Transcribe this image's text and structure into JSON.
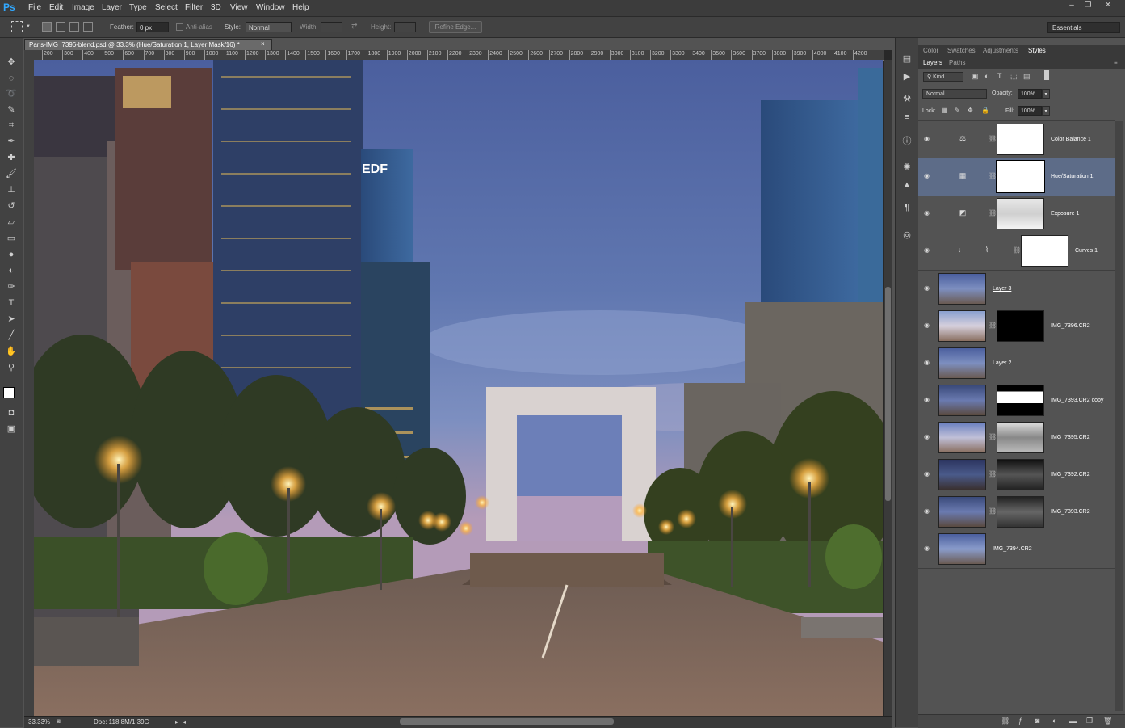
{
  "app": {
    "logo": "Ps",
    "accent": "#31a8ff"
  },
  "menu": [
    "File",
    "Edit",
    "Image",
    "Layer",
    "Type",
    "Select",
    "Filter",
    "3D",
    "View",
    "Window",
    "Help"
  ],
  "window_controls": {
    "minimize": "–",
    "restore": "❐",
    "close": "✕"
  },
  "options_bar": {
    "feather_label": "Feather:",
    "feather_value": "0 px",
    "antialias_label": "Anti-alias",
    "style_label": "Style:",
    "style_value": "Normal",
    "width_label": "Width:",
    "height_label": "Height:",
    "refine_edge": "Refine Edge...",
    "workspace": "Essentials"
  },
  "document": {
    "tab_title": "Paris-IMG_7396-blend.psd @ 33.3% (Hue/Saturation 1, Layer Mask/16) *",
    "zoom": "33.33%",
    "doc_size": "Doc: 118.8M/1.39G",
    "ruler_ticks": [
      "200",
      "300",
      "400",
      "500",
      "600",
      "700",
      "800",
      "900",
      "1000",
      "1100",
      "1200",
      "1300",
      "1400",
      "1500",
      "1600",
      "1700",
      "1800",
      "1900",
      "2000",
      "2100",
      "2200",
      "2300",
      "2400",
      "2500",
      "2600",
      "2700",
      "2800",
      "2900",
      "3000",
      "3100",
      "3200",
      "3300",
      "3400",
      "3500",
      "3600",
      "3700",
      "3800",
      "3900",
      "4000",
      "4100",
      "4200"
    ],
    "sign_text": "EDF"
  },
  "panels": {
    "top_tabs": [
      "Color",
      "Swatches",
      "Adjustments",
      "Styles"
    ],
    "top_active": "Styles",
    "layer_tabs": [
      "Layers",
      "Paths"
    ],
    "layer_active": "Layers",
    "filter_kind": "Kind",
    "blend_mode": "Normal",
    "opacity_label": "Opacity:",
    "opacity_value": "100%",
    "lock_label": "Lock:",
    "fill_label": "Fill:",
    "fill_value": "100%"
  },
  "layers": [
    {
      "name": "Color Balance 1",
      "type": "adjustment",
      "icon": "balance-icon",
      "mask": "white",
      "selected": false
    },
    {
      "name": "Hue/Saturation 1",
      "type": "adjustment",
      "icon": "hue-icon",
      "mask": "white",
      "selected": true
    },
    {
      "name": "Exposure 1",
      "type": "adjustment",
      "icon": "exposure-icon",
      "mask": "detailed",
      "selected": false
    },
    {
      "name": "Curves 1",
      "type": "adjustment",
      "icon": "curves-icon",
      "mask": "white",
      "clipped": true,
      "selected": false
    },
    {
      "name": "Layer 3",
      "type": "pixel",
      "selected": false
    },
    {
      "name": "IMG_7396.CR2",
      "type": "pixel",
      "mask": "black",
      "selected": false
    },
    {
      "name": "Layer 2",
      "type": "pixel",
      "selected": false
    },
    {
      "name": "IMG_7393.CR2 copy",
      "type": "pixel",
      "mask": "black-white",
      "selected": false
    },
    {
      "name": "IMG_7395.CR2",
      "type": "pixel",
      "mask": "detailed",
      "selected": false
    },
    {
      "name": "IMG_7392.CR2",
      "type": "pixel",
      "mask": "dark",
      "selected": false
    },
    {
      "name": "IMG_7393.CR2",
      "type": "pixel",
      "mask": "dark",
      "selected": false
    },
    {
      "name": "IMG_7394.CR2",
      "type": "pixel",
      "selected": false
    }
  ]
}
